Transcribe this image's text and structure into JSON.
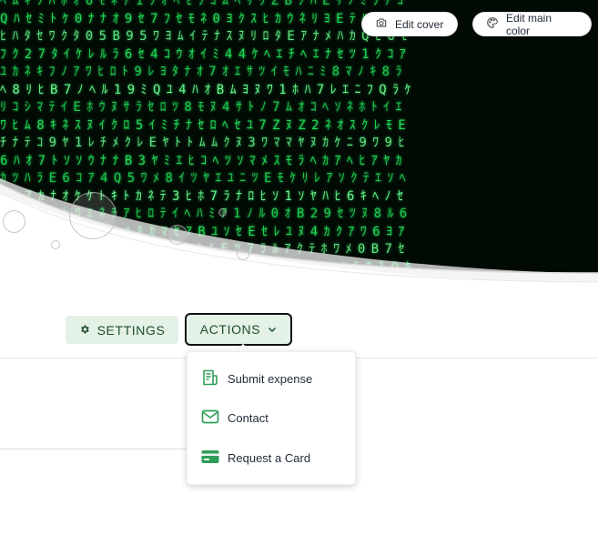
{
  "cover": {
    "edit_cover_label": "Edit cover",
    "edit_color_label": "Edit main color"
  },
  "nav": {
    "settings_label": "SETTINGS",
    "actions_label": "ACTIONS"
  },
  "actions_menu": {
    "items": [
      {
        "label": "Submit expense",
        "icon": "receipt-icon"
      },
      {
        "label": "Contact",
        "icon": "envelope-icon"
      },
      {
        "label": "Request a Card",
        "icon": "credit-card-icon"
      }
    ]
  },
  "colors": {
    "accent": "#2f9e57",
    "button_bg": "#e3f1e6",
    "matrix_green": "#1fdc55"
  }
}
